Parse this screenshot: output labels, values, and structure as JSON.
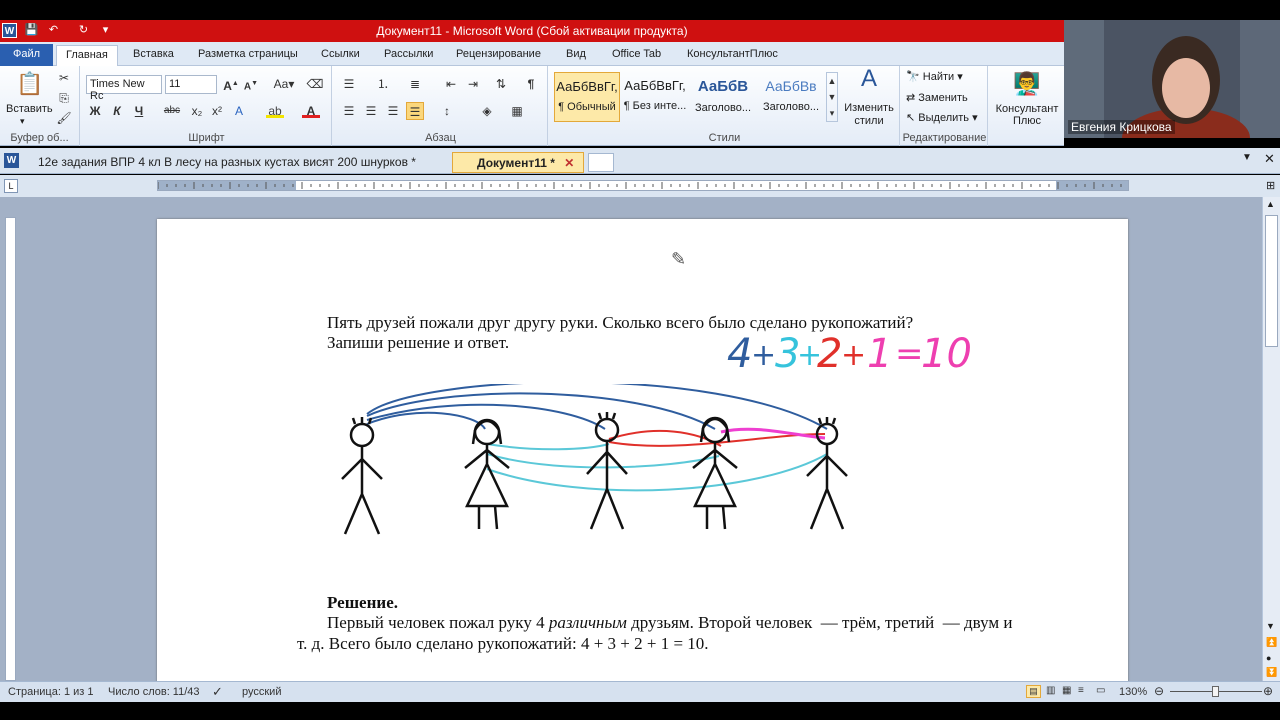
{
  "title_bar": {
    "title": "Документ11  -  Microsoft Word (Сбой активации продукта)",
    "app_icon": "W"
  },
  "ribbon_tabs": [
    "Файл",
    "Главная",
    "Вставка",
    "Разметка страницы",
    "Ссылки",
    "Рассылки",
    "Рецензирование",
    "Вид",
    "Office Tab",
    "КонсультантПлюс"
  ],
  "clipboard": {
    "paste_label": "Вставить",
    "group_label": "Буфер об..."
  },
  "font": {
    "name": "Times New Rc",
    "size": "11",
    "group_label": "Шрифт"
  },
  "paragraph": {
    "group_label": "Абзац"
  },
  "styles": {
    "items": [
      {
        "preview": "АаБбВвГг,",
        "name": "¶ Обычный"
      },
      {
        "preview": "АаБбВвГг,",
        "name": "¶ Без инте..."
      },
      {
        "preview": "АаБбВ",
        "name": "Заголово..."
      },
      {
        "preview": "АаБбВв",
        "name": "Заголово..."
      }
    ],
    "change_styles": "Изменить стили",
    "group_label": "Стили"
  },
  "editing": {
    "find": "Найти",
    "replace": "Заменить",
    "select": "Выделить",
    "group_label": "Редактирование"
  },
  "consultant": {
    "label": "Консультант Плюс",
    "group_label": "КонсультантПлюс"
  },
  "doc_tabs": [
    {
      "label": "12е задания ВПР 4 кл В лесу на разных кустах висят 200 шнурков *"
    },
    {
      "label": "Документ11 *"
    }
  ],
  "document": {
    "task_line1": "Пять друзей пожали друг другу руки. Сколько всего было сделано рукопожатий?",
    "task_line2": "Запиши решение и ответ.",
    "handwritten": {
      "t1": "4",
      "p1": "+",
      "t2": "3",
      "p2": "+",
      "t3": "2",
      "p3": "+",
      "t4": "1",
      "eq": "=",
      "res": "10"
    },
    "solution_title": "Решение.",
    "solution_line1_a": "Первый человек пожал руку 4 ",
    "solution_line1_em": "различным",
    "solution_line1_b": " друзьям. Второй человек  — трём, третий  — двум и",
    "solution_line2": "т. д. Всего было сделано рукопожатий: 4 + 3 + 2 + 1 = 10."
  },
  "status_bar": {
    "page": "Страница: 1 из 1",
    "words": "Число слов: 11/43",
    "language": "русский",
    "zoom": "130%"
  },
  "webcam": {
    "name": "Евгения Крицкова"
  },
  "colors": {
    "title_red": "#cf1010",
    "blue_line": "#2f5d9e",
    "cyan_line": "#5bc8d8",
    "red_line": "#e0302a",
    "magenta_line": "#ee3fd0"
  }
}
